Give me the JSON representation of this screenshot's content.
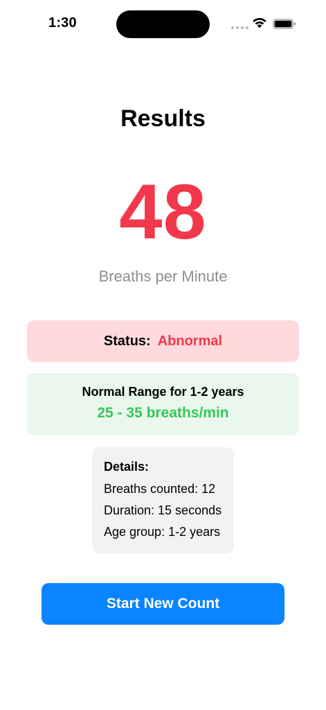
{
  "status_bar": {
    "time": "1:30",
    "wifi_icon": "wifi-icon",
    "battery_icon": "battery-icon"
  },
  "results": {
    "title": "Results",
    "breaths_per_minute": "48",
    "unit_label": "Breaths per Minute"
  },
  "status": {
    "label": "Status:",
    "value": "Abnormal",
    "value_color": "#f2384b",
    "card_color": "#ffd9dc"
  },
  "normal_range": {
    "title": "Normal Range for 1-2 years",
    "value": "25 - 35 breaths/min",
    "value_color": "#34c759",
    "card_color": "#eaf7ec"
  },
  "details": {
    "title": "Details:",
    "breaths_counted": "Breaths counted: 12",
    "duration": "Duration: 15 seconds",
    "age_group": "Age group: 1-2 years"
  },
  "actions": {
    "start_new_count_label": "Start New Count",
    "button_color": "#0a84ff"
  }
}
